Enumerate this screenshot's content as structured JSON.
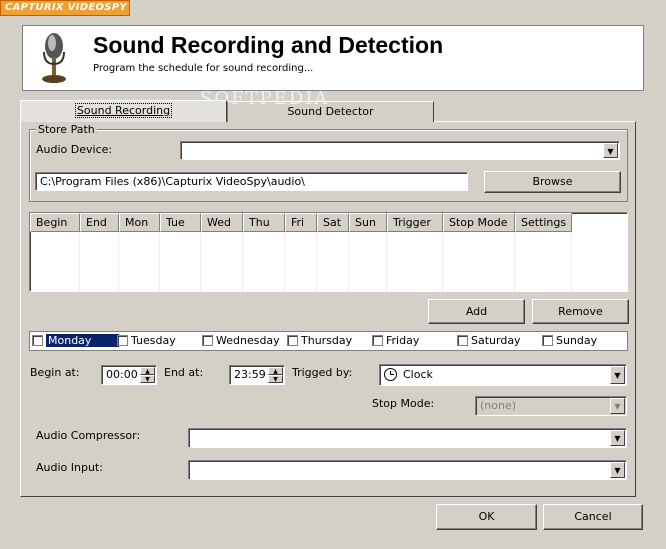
{
  "app": {
    "brand": "CAPTURIX VIDEOSPY"
  },
  "header": {
    "title": "Sound Recording and Detection",
    "subtitle": "Program the schedule for sound recording...",
    "icon": "microphone-icon"
  },
  "watermark": "SOFTPEDIA",
  "tabs": [
    {
      "label": "Sound Recording",
      "active": true
    },
    {
      "label": "Sound Detector",
      "active": false
    }
  ],
  "store_path": {
    "group_title": "Store Path",
    "audio_device_label": "Audio Device:",
    "audio_device_value": "",
    "path_value": "C:\\Program Files (x86)\\Capturix VideoSpy\\audio\\",
    "browse_label": "Browse"
  },
  "schedule_table": {
    "columns": [
      "Begin",
      "End",
      "Mon",
      "Tue",
      "Wed",
      "Thu",
      "Fri",
      "Sat",
      "Sun",
      "Trigger",
      "Stop Mode",
      "Settings"
    ],
    "rows": []
  },
  "buttons": {
    "add": "Add",
    "remove": "Remove",
    "ok": "OK",
    "cancel": "Cancel"
  },
  "days": [
    {
      "label": "Monday",
      "checked": false,
      "selected": true
    },
    {
      "label": "Tuesday",
      "checked": false,
      "selected": false
    },
    {
      "label": "Wednesday",
      "checked": false,
      "selected": false
    },
    {
      "label": "Thursday",
      "checked": false,
      "selected": false
    },
    {
      "label": "Friday",
      "checked": false,
      "selected": false
    },
    {
      "label": "Saturday",
      "checked": false,
      "selected": false
    },
    {
      "label": "Sunday",
      "checked": false,
      "selected": false
    }
  ],
  "timing": {
    "begin_label": "Begin at:",
    "begin_value": "00:00",
    "end_label": "End at:",
    "end_value": "23:59",
    "trigged_label": "Trigged by:",
    "trigged_value": "Clock",
    "stop_mode_label": "Stop Mode:",
    "stop_mode_value": "(none)"
  },
  "audio": {
    "compressor_label": "Audio Compressor:",
    "compressor_value": "",
    "input_label": "Audio Input:",
    "input_value": ""
  },
  "colors": {
    "selection": "#0a246a",
    "brand": "#f0a030",
    "window": "#d4d0c8"
  }
}
